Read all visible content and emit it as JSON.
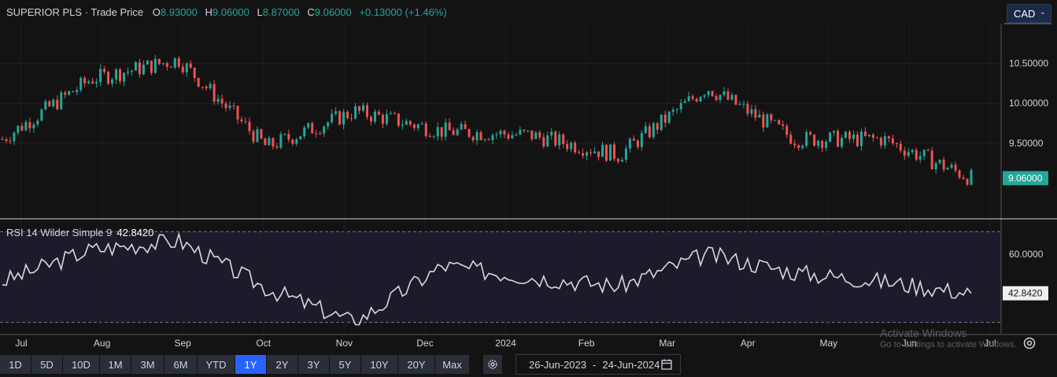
{
  "legend": {
    "title": "SUPERIOR PLS · Trade Price",
    "o_label": "O",
    "o_value": "8.93000",
    "h_label": "H",
    "h_value": "9.06000",
    "l_label": "L",
    "l_value": "8.87000",
    "c_label": "C",
    "c_value": "9.06000",
    "change": "+0.13000 (+1.46%)"
  },
  "currency": {
    "selected": "CAD"
  },
  "rsi": {
    "label": "RSI 14 Wilder Simple 9",
    "value": "42.8420"
  },
  "toolbar": {
    "ranges": [
      "1D",
      "5D",
      "10D",
      "1M",
      "3M",
      "6M",
      "YTD",
      "1Y",
      "2Y",
      "3Y",
      "5Y",
      "10Y",
      "20Y",
      "Max"
    ],
    "active": "1Y",
    "date_from": "26-Jun-2023",
    "date_sep": "-",
    "date_to": "24-Jun-2024"
  },
  "watermark": {
    "line1": "Activate Windows",
    "line2": "Go to Settings to activate Windows."
  },
  "colors": {
    "up": "#26a69a",
    "down": "#ef5350",
    "rsi_line": "#d9d9d9",
    "rsi_band": "#7e57c2"
  },
  "chart_data": [
    {
      "type": "candlestick",
      "title": "SUPERIOR PLS · Trade Price",
      "x_ticks": [
        "Jul",
        "Aug",
        "Sep",
        "Oct",
        "Nov",
        "Dec",
        "2024",
        "Feb",
        "Mar",
        "Apr",
        "May",
        "Jun",
        "Jul"
      ],
      "y_ticks": [
        10.5,
        10.0,
        9.5
      ],
      "ylim": [
        8.55,
        11.0
      ],
      "last_price": "9.06000",
      "grid": true,
      "monthly_closes": [
        {
          "month": "Jul 2023",
          "close": 9.55
        },
        {
          "month": "Aug 2023",
          "close": 10.3
        },
        {
          "month": "Sep 2023",
          "close": 10.55
        },
        {
          "month": "Oct 2023",
          "close": 9.45
        },
        {
          "month": "Nov 2023",
          "close": 9.9
        },
        {
          "month": "Dec 2023",
          "close": 9.65
        },
        {
          "month": "Jan 2024",
          "close": 9.6
        },
        {
          "month": "Feb 2024",
          "close": 9.35
        },
        {
          "month": "Mar 2024",
          "close": 10.2
        },
        {
          "month": "Apr 2024",
          "close": 9.55
        },
        {
          "month": "May 2024",
          "close": 9.55
        },
        {
          "month": "Jun 2024",
          "close": 9.06
        }
      ]
    },
    {
      "type": "line",
      "title": "RSI 14 Wilder Simple 9",
      "y_ticks": [
        60.0
      ],
      "band": [
        30,
        70
      ],
      "ylim": [
        25,
        75
      ],
      "last_value": "42.8420",
      "points": [
        {
          "month": "Jul 2023",
          "value": 48
        },
        {
          "month": "Aug 2023",
          "value": 62
        },
        {
          "month": "Sep 2023",
          "value": 66
        },
        {
          "month": "Oct 2023",
          "value": 45
        },
        {
          "month": "Nov 2023",
          "value": 30
        },
        {
          "month": "Dec 2023",
          "value": 55
        },
        {
          "month": "Jan 2024",
          "value": 50
        },
        {
          "month": "Feb 2024",
          "value": 46
        },
        {
          "month": "Mar 2024",
          "value": 60
        },
        {
          "month": "Apr 2024",
          "value": 52
        },
        {
          "month": "May 2024",
          "value": 48
        },
        {
          "month": "Jun 2024",
          "value": 42.842
        }
      ]
    }
  ]
}
